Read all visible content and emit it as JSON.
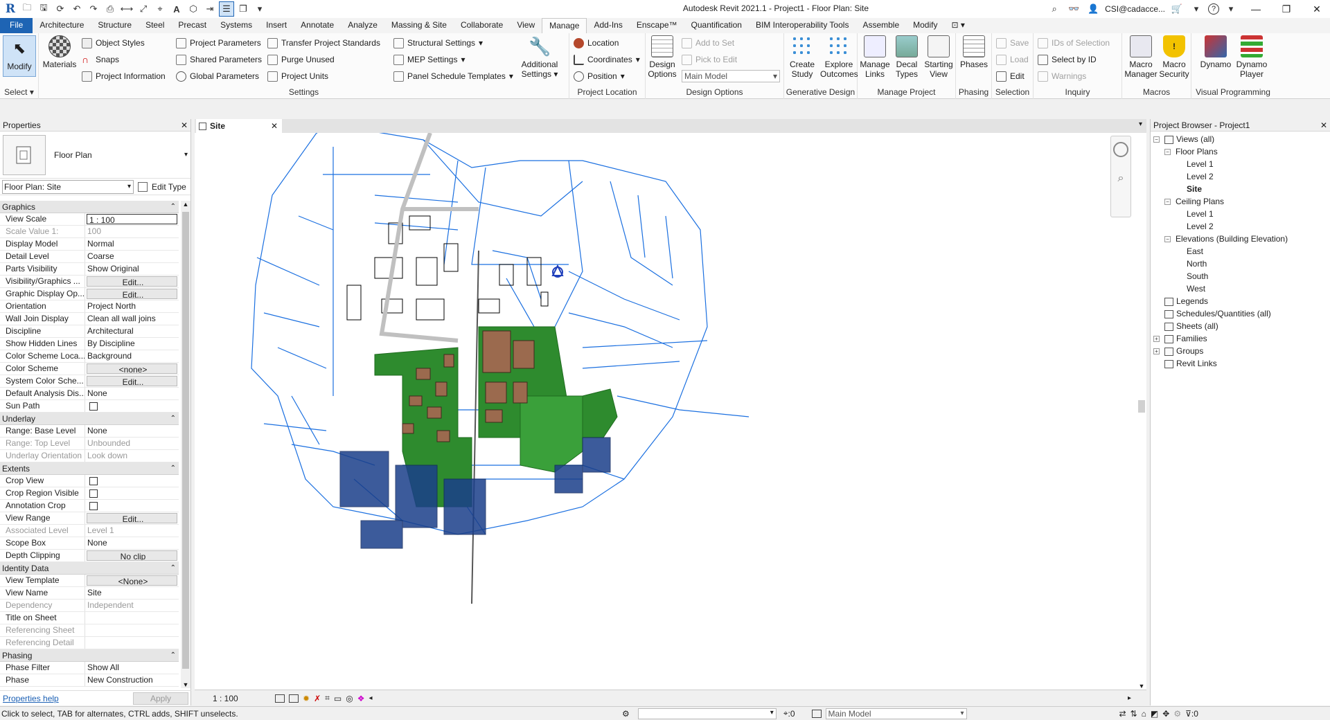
{
  "app": {
    "title": "Autodesk Revit 2021.1 - Project1 - Floor Plan: Site",
    "logo": "R",
    "user": "CSI@cadacce...",
    "help": "?"
  },
  "ribbon_tabs": [
    "File",
    "Architecture",
    "Structure",
    "Steel",
    "Precast",
    "Systems",
    "Insert",
    "Annotate",
    "Analyze",
    "Massing & Site",
    "Collaborate",
    "View",
    "Manage",
    "Add-Ins",
    "Enscape™",
    "Quantification",
    "BIM Interoperability Tools",
    "Assemble",
    "Modify"
  ],
  "active_tab": "Manage",
  "ribbon": {
    "select": {
      "modify": "Modify",
      "label": "Select"
    },
    "settings": {
      "materials": "Materials",
      "object_styles": "Object  Styles",
      "snaps": "Snaps",
      "project_information": "Project  Information",
      "project_parameters": "Project  Parameters",
      "shared_parameters": "Shared  Parameters",
      "global_parameters": "Global  Parameters",
      "transfer_standards": "Transfer  Project Standards",
      "purge_unused": "Purge  Unused",
      "project_units": "Project  Units",
      "structural_settings": "Structural  Settings",
      "mep_settings": "MEP  Settings",
      "panel_schedule_templates": "Panel Schedule  Templates",
      "additional_settings_1": "Additional",
      "additional_settings_2": "Settings",
      "label": "Settings"
    },
    "project_location": {
      "location": "Location",
      "coordinates": "Coordinates",
      "position": "Position",
      "label": "Project Location"
    },
    "design_options": {
      "design_options_1": "Design",
      "design_options_2": "Options",
      "add_to_set": "Add to Set",
      "pick_to_edit": "Pick to Edit",
      "main_model": "Main Model",
      "label": "Design Options"
    },
    "generative": {
      "create_study_1": "Create",
      "create_study_2": "Study",
      "explore_outcomes_1": "Explore",
      "explore_outcomes_2": "Outcomes",
      "label": "Generative Design"
    },
    "manage_project": {
      "manage_links_1": "Manage",
      "manage_links_2": "Links",
      "decal_types_1": "Decal",
      "decal_types_2": "Types",
      "starting_view_1": "Starting",
      "starting_view_2": "View",
      "label": "Manage Project"
    },
    "phasing": {
      "phases": "Phases",
      "label": "Phasing"
    },
    "selection": {
      "save": "Save",
      "load": "Load",
      "edit": "Edit",
      "label": "Selection"
    },
    "inquiry": {
      "ids_of_selection": "IDs of  Selection",
      "select_by_id": "Select  by ID",
      "warnings": "Warnings",
      "label": "Inquiry"
    },
    "macros": {
      "macro_manager_1": "Macro",
      "macro_manager_2": "Manager",
      "macro_security_1": "Macro",
      "macro_security_2": "Security",
      "label": "Macros"
    },
    "visual_programming": {
      "dynamo": "Dynamo",
      "dynamo_player_1": "Dynamo",
      "dynamo_player_2": "Player",
      "label": "Visual Programming"
    }
  },
  "properties": {
    "title": "Properties",
    "type_name": "Floor Plan",
    "instance": "Floor Plan: Site",
    "edit_type": "Edit Type",
    "groups": [
      {
        "name": "Graphics",
        "rows": [
          {
            "n": "View Scale",
            "v": "1 : 100",
            "k": "boxed"
          },
          {
            "n": "Scale Value    1:",
            "v": "100",
            "k": "dis"
          },
          {
            "n": "Display Model",
            "v": "Normal"
          },
          {
            "n": "Detail Level",
            "v": "Coarse"
          },
          {
            "n": "Parts Visibility",
            "v": "Show Original"
          },
          {
            "n": "Visibility/Graphics ...",
            "v": "Edit...",
            "k": "btn"
          },
          {
            "n": "Graphic Display Op...",
            "v": "Edit...",
            "k": "btn"
          },
          {
            "n": "Orientation",
            "v": "Project North"
          },
          {
            "n": "Wall Join Display",
            "v": "Clean all wall joins"
          },
          {
            "n": "Discipline",
            "v": "Architectural"
          },
          {
            "n": "Show Hidden Lines",
            "v": "By Discipline"
          },
          {
            "n": "Color Scheme Loca...",
            "v": "Background"
          },
          {
            "n": "Color Scheme",
            "v": "<none>",
            "k": "btn"
          },
          {
            "n": "System Color Sche...",
            "v": "Edit...",
            "k": "btn"
          },
          {
            "n": "Default Analysis Dis...",
            "v": "None"
          },
          {
            "n": "Sun Path",
            "v": "",
            "k": "chk"
          }
        ]
      },
      {
        "name": "Underlay",
        "rows": [
          {
            "n": "Range: Base Level",
            "v": "None"
          },
          {
            "n": "Range: Top Level",
            "v": "Unbounded",
            "k": "dis"
          },
          {
            "n": "Underlay Orientation",
            "v": "Look down",
            "k": "dis"
          }
        ]
      },
      {
        "name": "Extents",
        "rows": [
          {
            "n": "Crop View",
            "v": "",
            "k": "chk"
          },
          {
            "n": "Crop Region Visible",
            "v": "",
            "k": "chk"
          },
          {
            "n": "Annotation Crop",
            "v": "",
            "k": "chk"
          },
          {
            "n": "View Range",
            "v": "Edit...",
            "k": "btn"
          },
          {
            "n": "Associated Level",
            "v": "Level 1",
            "k": "dis"
          },
          {
            "n": "Scope Box",
            "v": "None"
          },
          {
            "n": "Depth Clipping",
            "v": "No clip",
            "k": "btn"
          }
        ]
      },
      {
        "name": "Identity Data",
        "rows": [
          {
            "n": "View Template",
            "v": "<None>",
            "k": "btn"
          },
          {
            "n": "View Name",
            "v": "Site"
          },
          {
            "n": "Dependency",
            "v": "Independent",
            "k": "dis"
          },
          {
            "n": "Title on Sheet",
            "v": ""
          },
          {
            "n": "Referencing Sheet",
            "v": "",
            "k": "dis"
          },
          {
            "n": "Referencing Detail",
            "v": "",
            "k": "dis"
          }
        ]
      },
      {
        "name": "Phasing",
        "rows": [
          {
            "n": "Phase Filter",
            "v": "Show All"
          },
          {
            "n": "Phase",
            "v": "New Construction"
          }
        ]
      }
    ],
    "help": "Properties help",
    "apply": "Apply"
  },
  "view": {
    "tab": "Site",
    "scale": "1 : 100"
  },
  "browser": {
    "title": "Project Browser - Project1",
    "nodes": [
      {
        "t": "Views (all)",
        "d": 0,
        "tg": "−",
        "ic": true
      },
      {
        "t": "Floor Plans",
        "d": 1,
        "tg": "−"
      },
      {
        "t": "Level 1",
        "d": 2
      },
      {
        "t": "Level 2",
        "d": 2
      },
      {
        "t": "Site",
        "d": 2,
        "sel": true
      },
      {
        "t": "Ceiling Plans",
        "d": 1,
        "tg": "−"
      },
      {
        "t": "Level 1",
        "d": 2
      },
      {
        "t": "Level 2",
        "d": 2
      },
      {
        "t": "Elevations (Building Elevation)",
        "d": 1,
        "tg": "−"
      },
      {
        "t": "East",
        "d": 2
      },
      {
        "t": "North",
        "d": 2
      },
      {
        "t": "South",
        "d": 2
      },
      {
        "t": "West",
        "d": 2
      },
      {
        "t": "Legends",
        "d": 0,
        "ic": true
      },
      {
        "t": "Schedules/Quantities (all)",
        "d": 0,
        "ic": true
      },
      {
        "t": "Sheets (all)",
        "d": 0,
        "ic": true
      },
      {
        "t": "Families",
        "d": 0,
        "tg": "+",
        "ic": true
      },
      {
        "t": "Groups",
        "d": 0,
        "tg": "+",
        "ic": true
      },
      {
        "t": "Revit Links",
        "d": 0,
        "ic": true
      }
    ]
  },
  "status": {
    "text": "Click to select, TAB for alternates, CTRL adds, SHIFT unselects.",
    "zero1": ":0",
    "main_model": "Main Model",
    "zero2": ":0"
  },
  "colors": {
    "accent": "#1e64b4",
    "site_line": "#1a6fe0",
    "green": "#2e8b2e",
    "brown": "#9b6a4e"
  }
}
